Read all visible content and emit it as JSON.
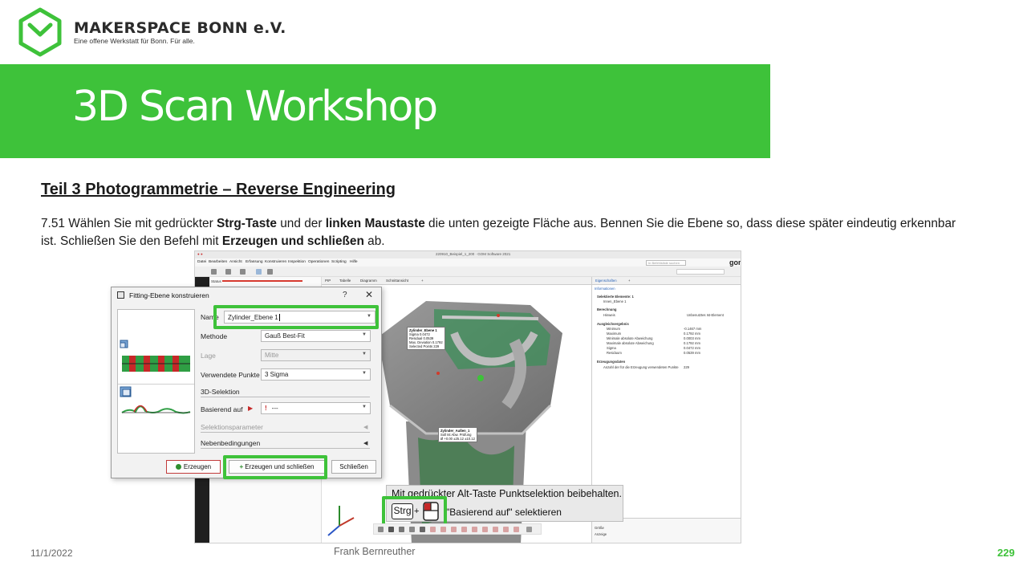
{
  "brand": {
    "name": "MAKERSPACE BONN e.V.",
    "tagline": "Eine offene Werkstatt für Bonn. Für alle.",
    "color": "#3ec23a"
  },
  "slide": {
    "title": "3D Scan Workshop",
    "section_heading": "Teil 3  Photogrammetrie  – Reverse Engineering",
    "instruction": {
      "p1": "7.51 Wählen Sie mit gedrückter ",
      "b1": "Strg-Taste",
      "p2": " und der ",
      "b2": "linken Maustaste",
      "p3": " die unten gezeigte Fläche aus. Bennen Sie die Ebene so, dass diese später eindeutig erkennbar ist. Schließen Sie den Befehl mit ",
      "b3": "Erzeugen und schließen",
      "p4": " ab."
    }
  },
  "footer": {
    "date": "11/1/2022",
    "author": "Frank Bernreuther",
    "page": "229"
  },
  "app": {
    "title": "220910_Beispiel_1_200 · GOM Software 2021",
    "menu": [
      "Datei",
      "Bearbeiten",
      "Ansicht",
      "Erfassung",
      "Konstruieren",
      "Inspektion",
      "Operationen",
      "Scripting",
      "Hilfe"
    ],
    "search_placeholder": "In Befehlsliste suchen",
    "logo": "gom",
    "status_label": "Status",
    "tabs": [
      "PIP",
      "Tabelle",
      "Diagramm",
      "Schnittansicht",
      "+"
    ],
    "right_panel": {
      "tabs": [
        "Eigenschaften",
        "+"
      ],
      "link": "Informationen",
      "rows": [
        "Selektierte Elemente: 1",
        "Innen_Ebene 1",
        "Berechnung",
        "Hinweis",
        "Unbenutztes Ist-Element",
        "Ausgleichsergebnis",
        "Minimum",
        "-0.1467 mm",
        "Maximum",
        "0.1792 mm",
        "Minimale absolute Abweichung",
        "0.0003 mm",
        "Maximale absolute Abweichung",
        "0.1792 mm",
        "Sigma",
        "0.0472 mm",
        "Residuum",
        "0.0539 mm",
        "Erzeugungsdaten",
        "Anzahl der für die Erzeugung verwendeten Punkte",
        "229",
        "Größe",
        "Anzeige"
      ]
    },
    "viewport_labels": {
      "plane": {
        "title": "Zylinder_Ebene 1",
        "rows": [
          "Sigma  0.0472",
          "Residual  0.0539",
          "Max. Deviation  0.1792",
          "Selected Points  229"
        ]
      },
      "cylinder": {
        "title": "Zylinder_Außen_1",
        "rows": [
          "Soll  Ist  Abw.  Prüfung",
          "Ø  +0.00  ±25.12  ±10.12"
        ]
      }
    }
  },
  "dialog": {
    "title": "Fitting-Ebene konstruieren",
    "help": "?",
    "close": "✕",
    "fields": {
      "name_label": "Name",
      "name_value": "Zylinder_Ebene 1",
      "methode_label": "Methode",
      "methode_value": "Gauß Best-Fit",
      "lage_label": "Lage",
      "lage_value": "Mitte",
      "punkte_label": "Verwendete Punkte",
      "punkte_value": "3 Sigma",
      "selektion_group": "3D-Selektion",
      "basierend_label": "Basierend auf",
      "basierend_value": "---",
      "selparam_group": "Selektionsparameter",
      "neben_group": "Nebenbedingungen"
    },
    "buttons": {
      "create": "Erzeugen",
      "create_close": "Erzeugen und schließen",
      "close": "Schließen"
    }
  },
  "tooltip": {
    "line1": "Mit gedrückter Alt-Taste Punktselektion beibehalten.",
    "key": "Strg",
    "plus": "+",
    "line2": "\"Basierend auf\" selektieren"
  }
}
